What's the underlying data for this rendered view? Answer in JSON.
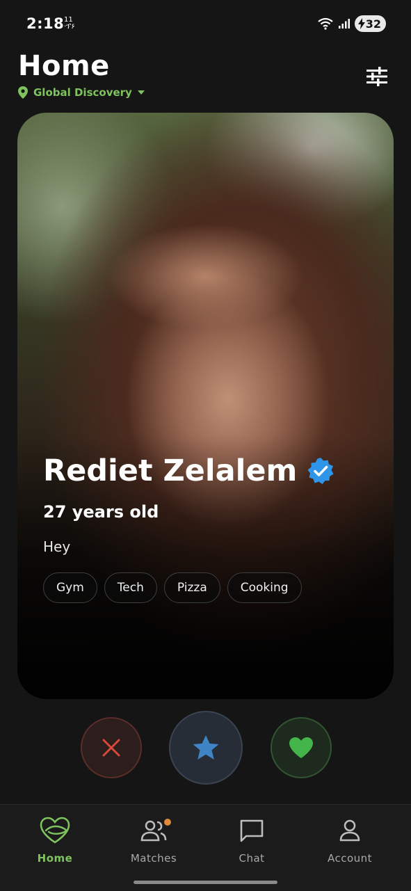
{
  "status_bar": {
    "time": "2:18",
    "mini_top": "11",
    "mini_bottom": "·ፕ۶",
    "battery": "32"
  },
  "header": {
    "title": "Home",
    "location_mode": "Global Discovery"
  },
  "profile": {
    "name": "Rediet Zelalem",
    "verified": true,
    "age_text": "27 years old",
    "bio": "Hey",
    "interests": [
      "Gym",
      "Tech",
      "Pizza",
      "Cooking"
    ]
  },
  "actions": {
    "dislike_icon": "close-icon",
    "superlike_icon": "star-icon",
    "like_icon": "heart-icon"
  },
  "bottom_nav": [
    {
      "label": "Home",
      "icon": "heart-logo-icon",
      "active": true
    },
    {
      "label": "Matches",
      "icon": "people-icon",
      "badge": true
    },
    {
      "label": "Chat",
      "icon": "chat-bubble-icon"
    },
    {
      "label": "Account",
      "icon": "person-icon"
    }
  ],
  "colors": {
    "accent_green": "#7ec35d",
    "verified_blue": "#2f95e8",
    "dislike_red": "#d9483b",
    "star_blue": "#3f84c4",
    "like_green": "#43b54a",
    "badge_orange": "#e08a3a"
  }
}
